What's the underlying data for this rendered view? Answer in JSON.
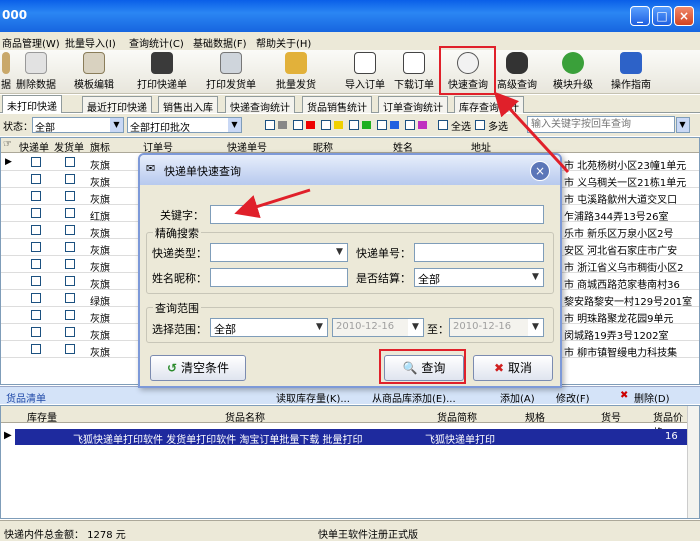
{
  "window": {
    "title": "000"
  },
  "menu": [
    "商品管理(W)",
    "批量导入(I)",
    "查询统计(C)",
    "基础数据(F)",
    "帮助关于(H)"
  ],
  "toolbar": [
    {
      "label": "据",
      "icon": "data-icon"
    },
    {
      "label": "删除数据",
      "icon": "delete-data-icon"
    },
    {
      "label": "模板编辑",
      "icon": "template-edit-icon"
    },
    {
      "label": "打印快递单",
      "icon": "print-express-icon"
    },
    {
      "label": "打印发货单",
      "icon": "print-invoice-icon"
    },
    {
      "label": "批量发货",
      "icon": "batch-ship-icon"
    },
    {
      "label": "导入订单",
      "icon": "import-order-icon"
    },
    {
      "label": "下载订单",
      "icon": "download-order-icon"
    },
    {
      "label": "快速查询",
      "icon": "quick-query-icon"
    },
    {
      "label": "高级查询",
      "icon": "advanced-query-icon"
    },
    {
      "label": "模块升级",
      "icon": "module-upgrade-icon"
    },
    {
      "label": "操作指南",
      "icon": "guide-icon"
    }
  ],
  "tabs": [
    "未打印快递",
    "最近打印快递",
    "销售出入库",
    "快递查询统计",
    "货品销售统计",
    "订单查询统计",
    "库存查询统计"
  ],
  "filter": {
    "status_label": "状态：",
    "status_value": "全部",
    "batch_value": "全部打印批次",
    "select_all": "全选",
    "multi_select": "多选",
    "search_placeholder": "输入关键字按回车查询"
  },
  "grid": {
    "headers": [
      "快递单",
      "发货单",
      "旗标",
      "订单号",
      "快递单号",
      "昵称",
      "姓名",
      "地址"
    ],
    "rows": [
      {
        "flag": "灰旗",
        "addr": "市 北苑杨树小区23幢1单元"
      },
      {
        "flag": "灰旗",
        "addr": "市 义乌稠关一区21栋1单元"
      },
      {
        "flag": "灰旗",
        "addr": "市 屯溪路歙州大道交叉口"
      },
      {
        "flag": "红旗",
        "addr": "乍浦路344弄13号26室"
      },
      {
        "flag": "灰旗",
        "addr": "乐市 新乐区万泉小区2号"
      },
      {
        "flag": "灰旗",
        "addr": "安区 河北省石家庄市广安"
      },
      {
        "flag": "灰旗",
        "addr": "市 浙江省义乌市稠街小区2"
      },
      {
        "flag": "灰旗",
        "addr": "市 商城西路范家巷南村36"
      },
      {
        "flag": "绿旗",
        "addr": "黎安路黎安一村129号201室"
      },
      {
        "flag": "灰旗",
        "addr": "市 明珠路聚龙花园9单元"
      },
      {
        "flag": "灰旗",
        "addr": "闵城路19弄3号1202室"
      },
      {
        "flag": "灰旗",
        "addr": "市 柳市镇智缦电力科技集"
      }
    ]
  },
  "goods": {
    "title": "货品清单",
    "actions": [
      "读取库存量(K)...",
      "从商品库添加(E)...",
      "添加(A)",
      "修改(F)",
      "删除(D)"
    ],
    "headers": [
      "库存量",
      "货品名称",
      "货品简称",
      "规格",
      "货号",
      "货品价格"
    ],
    "row": {
      "name": "飞狐快递单打印软件 发货单打印软件 淘宝订单批量下载 批量打印",
      "short": "飞狐快递单打印",
      "price": "16"
    }
  },
  "status": {
    "total": "快递内件总金额：  1278 元",
    "reg": "快单王软件注册正式版"
  },
  "dialog": {
    "title": "快递单快速查询",
    "keyword_label": "关键字：",
    "precise_legend": "精确搜索",
    "type_label": "快递类型：",
    "number_label": "快递单号：",
    "nick_label": "姓名昵称：",
    "settled_label": "是否结算：",
    "settled_value": "全部",
    "range_legend": "查询范围",
    "range_label": "选择范围：",
    "range_value": "全部",
    "date_from": "2010-12-16",
    "date_to_label": "至：",
    "date_to": "2010-12-16",
    "clear_label": "清空条件",
    "query_label": "查询",
    "cancel_label": "取消"
  }
}
